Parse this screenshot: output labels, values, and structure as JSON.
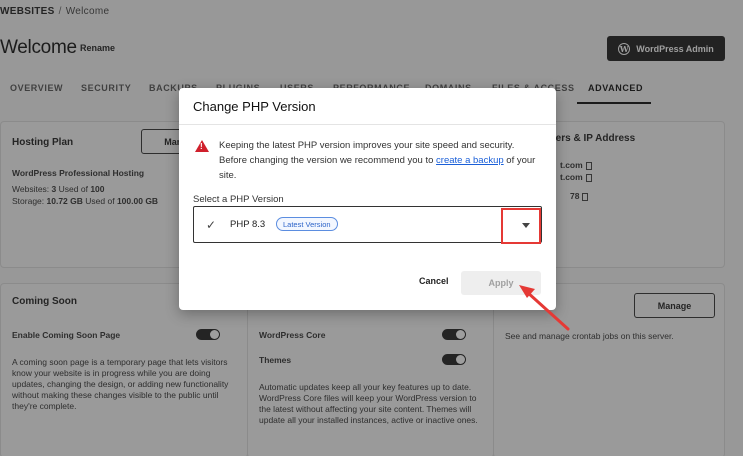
{
  "breadcrumb": {
    "root": "WEBSITES",
    "separator": "/",
    "current": "Welcome"
  },
  "header": {
    "title": "Welcome",
    "rename_label": "Rename",
    "wp_admin_label": "WordPress Admin"
  },
  "tabs": [
    {
      "label": "OVERVIEW"
    },
    {
      "label": "SECURITY"
    },
    {
      "label": "BACKUPS"
    },
    {
      "label": "PLUGINS"
    },
    {
      "label": "USERS"
    },
    {
      "label": "PERFORMANCE"
    },
    {
      "label": "DOMAINS"
    },
    {
      "label": "FILES & ACCESS"
    },
    {
      "label": "ADVANCED"
    }
  ],
  "hosting_plan": {
    "title": "Hosting Plan",
    "manage_label": "Manage",
    "plan_name": "WordPress Professional Hosting",
    "websites_label": "Websites:",
    "websites_used": "3",
    "websites_of": "Used of",
    "websites_total": "100",
    "storage_label": "Storage:",
    "storage_used": "10.72 GB",
    "storage_of": "Used of",
    "storage_total": "100.00 GB"
  },
  "servers": {
    "title": "Servers & IP Address",
    "line1": "t.com",
    "line2": "t.com",
    "line3": "78"
  },
  "coming_soon": {
    "title": "Coming Soon",
    "toggle_label": "Enable Coming Soon Page",
    "description": "A coming soon page is a temporary page that lets visitors know your website is in progress while you are doing updates, changing the design, or adding new functionality without making these changes visible to the public until they're complete."
  },
  "auto_updates": {
    "core_label": "WordPress Core",
    "themes_label": "Themes",
    "description": "Automatic updates keep all your key features up to date. WordPress Core files will keep your WordPress version to the latest without affecting your site content. Themes will update all your installed instances, active or inactive ones."
  },
  "cron": {
    "manage_label": "Manage",
    "description": "See and manage crontab jobs on this server."
  },
  "modal": {
    "title": "Change PHP Version",
    "warning_part1": "Keeping the latest PHP version improves your site speed and security. Before changing the version we recommend you to ",
    "warning_link": "create a backup",
    "warning_part2": " of your site.",
    "select_label": "Select a PHP Version",
    "selected_value": "PHP 8.3",
    "selected_badge": "Latest Version",
    "cancel_label": "Cancel",
    "apply_label": "Apply"
  },
  "colors": {
    "accent": "#1e1e1e",
    "warning": "#d0202c",
    "link": "#1a5fd8",
    "annotation": "#e53935"
  }
}
